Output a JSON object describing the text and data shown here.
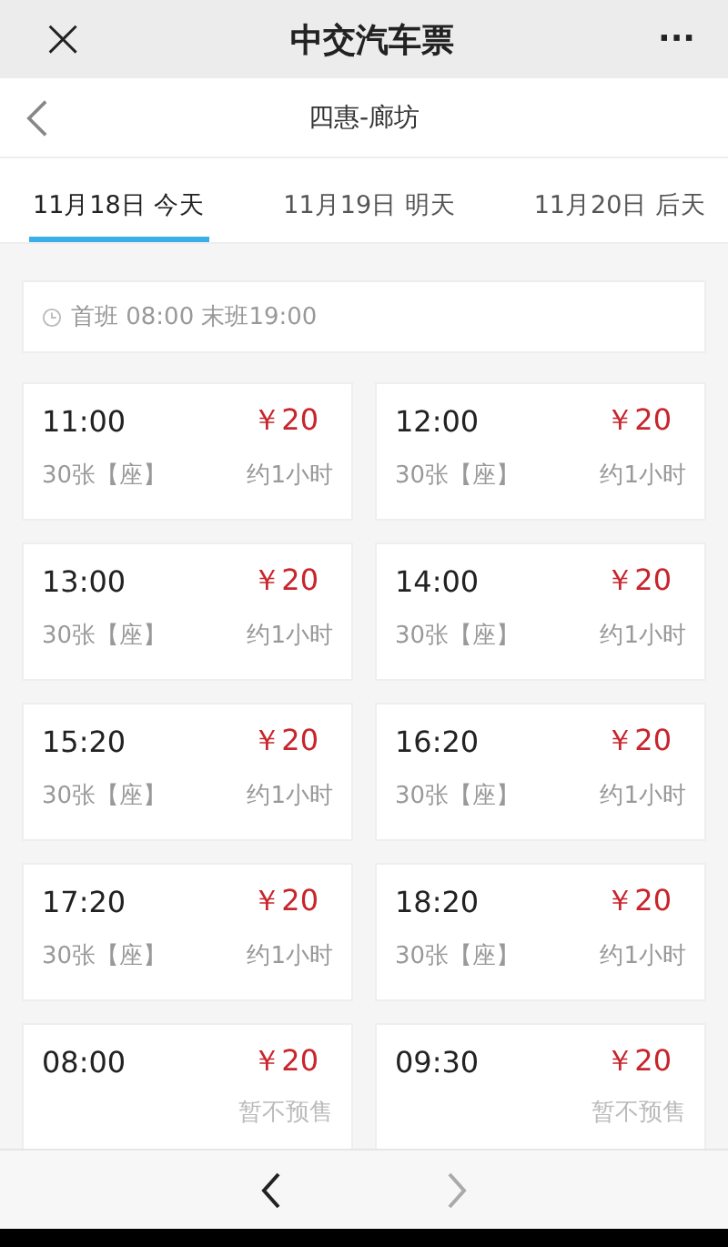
{
  "top_bar": {
    "close": "×",
    "title": "中交汽车票",
    "more": "···"
  },
  "nav_bar": {
    "title": "四惠-廊坊"
  },
  "date_tabs": [
    {
      "label": "11月18日 今天",
      "selected": true
    },
    {
      "label": "11月19日 明天",
      "selected": false
    },
    {
      "label": "11月20日 后天",
      "selected": false
    }
  ],
  "schedule_info": "首班 08:00 末班19:00",
  "departures": [
    {
      "kind": "bookable",
      "time": "11:00",
      "price": "￥20",
      "seats": "30张【座】",
      "duration": "约1小时"
    },
    {
      "kind": "bookable",
      "time": "12:00",
      "price": "￥20",
      "seats": "30张【座】",
      "duration": "约1小时"
    },
    {
      "kind": "bookable",
      "time": "13:00",
      "price": "￥20",
      "seats": "30张【座】",
      "duration": "约1小时"
    },
    {
      "kind": "bookable",
      "time": "14:00",
      "price": "￥20",
      "seats": "30张【座】",
      "duration": "约1小时"
    },
    {
      "kind": "bookable",
      "time": "15:20",
      "price": "￥20",
      "seats": "30张【座】",
      "duration": "约1小时"
    },
    {
      "kind": "bookable",
      "time": "16:20",
      "price": "￥20",
      "seats": "30张【座】",
      "duration": "约1小时"
    },
    {
      "kind": "bookable",
      "time": "17:20",
      "price": "￥20",
      "seats": "30张【座】",
      "duration": "约1小时"
    },
    {
      "kind": "bookable",
      "time": "18:20",
      "price": "￥20",
      "seats": "30张【座】",
      "duration": "约1小时"
    },
    {
      "kind": "no_presale",
      "time": "08:00",
      "price": "￥20",
      "note": "暂不预售"
    },
    {
      "kind": "no_presale",
      "time": "09:30",
      "price": "￥20",
      "note": "暂不预售"
    }
  ],
  "bottom_bar": {
    "back": {
      "disabled": false
    },
    "forward": {
      "disabled": true
    }
  }
}
